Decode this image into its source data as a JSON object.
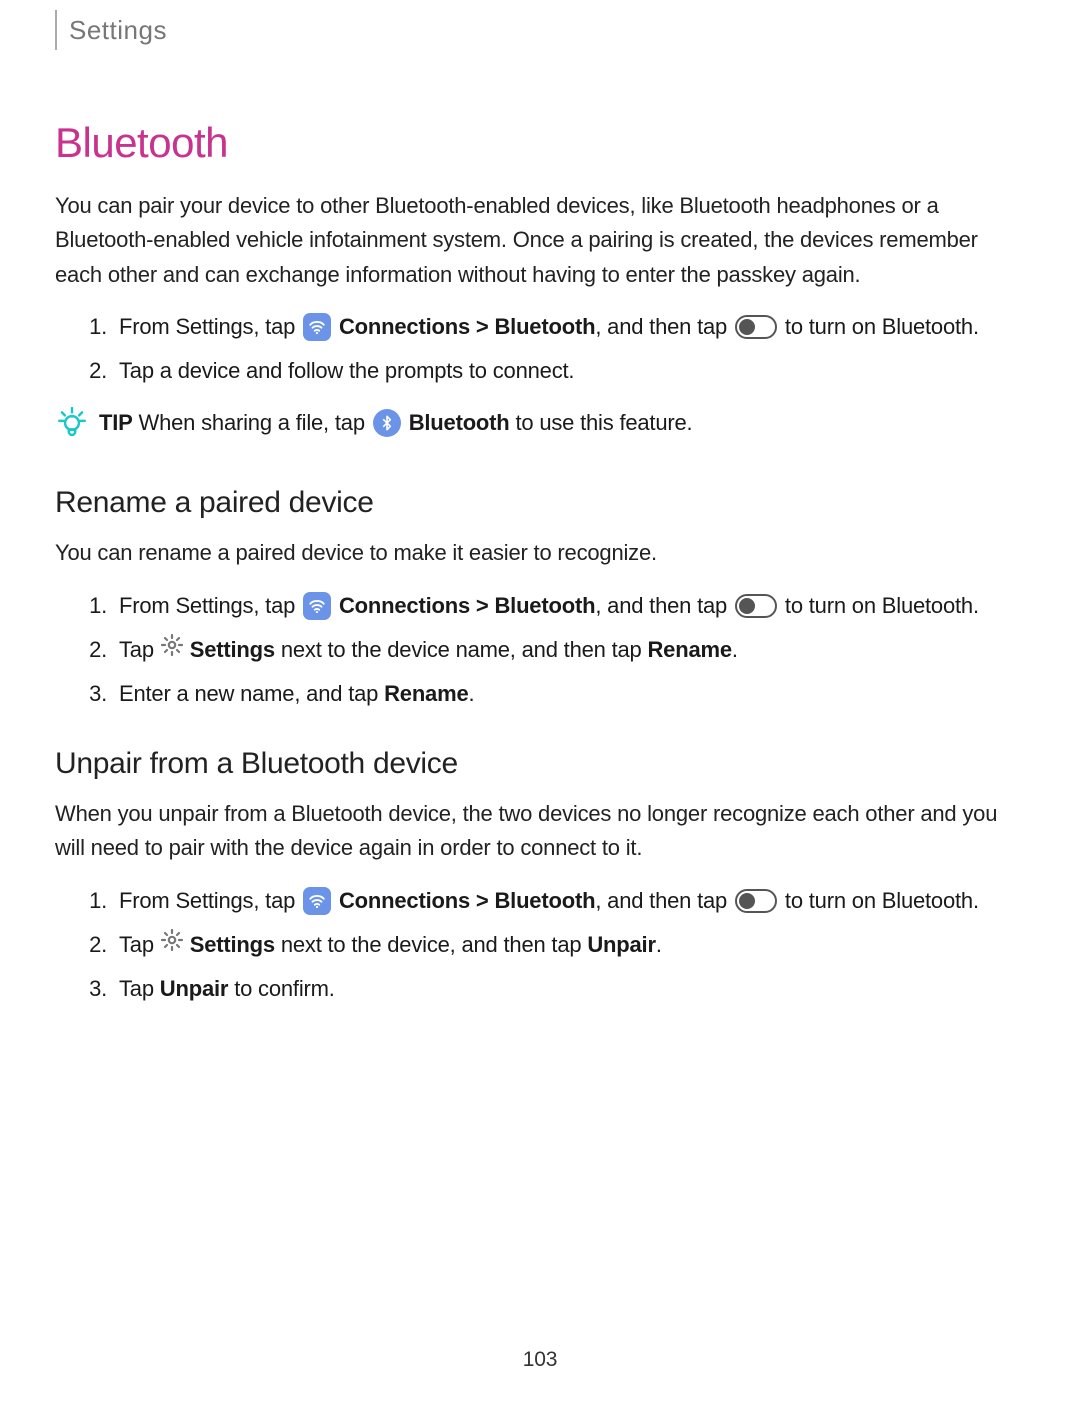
{
  "breadcrumb": "Settings",
  "h1": "Bluetooth",
  "intro1": "You can pair your device to other Bluetooth-enabled devices, like Bluetooth headphones or a Bluetooth-enabled vehicle infotainment system. Once a pairing is created, the devices remember each other and can exchange information without having to enter the passkey again.",
  "step1_part1": "From Settings, tap ",
  "step1_conn": " Connections > Bluetooth",
  "step1_part2": ", and then tap ",
  "step1_part3": " to turn on Bluetooth.",
  "step2": "Tap a device and follow the prompts to connect.",
  "tip_label": "TIP",
  "tip_part1": "  When sharing a file, tap ",
  "tip_bt": " Bluetooth",
  "tip_part2": " to use this feature.",
  "h2a": "Rename a paired device",
  "intro2": "You can rename a paired device to make it easier to recognize.",
  "rename_s1_p1": "From Settings, tap ",
  "rename_s1_conn": " Connections > Bluetooth",
  "rename_s1_p2": ", and then tap ",
  "rename_s1_p3": " to turn on Bluetooth.",
  "rename_s2_p1": "Tap ",
  "rename_s2_settings": " Settings",
  "rename_s2_p2": " next to the device name, and then tap ",
  "rename_s2_rename": "Rename",
  "rename_s2_p3": ".",
  "rename_s3_p1": "Enter a new name, and tap ",
  "rename_s3_rename": "Rename",
  "rename_s3_p2": ".",
  "h2b": "Unpair from a Bluetooth device",
  "intro3": "When you unpair from a Bluetooth device, the two devices no longer recognize each other and you will need to pair with the device again in order to connect to it.",
  "unpair_s1_p1": "From Settings, tap ",
  "unpair_s1_conn": " Connections > Bluetooth",
  "unpair_s1_p2": ", and then tap ",
  "unpair_s1_p3": " to turn on Bluetooth.",
  "unpair_s2_p1": "Tap ",
  "unpair_s2_settings": " Settings",
  "unpair_s2_p2": " next to the device, and then tap ",
  "unpair_s2_unpair": "Unpair",
  "unpair_s2_p3": ".",
  "unpair_s3_p1": "Tap ",
  "unpair_s3_unpair": "Unpair",
  "unpair_s3_p2": " to confirm.",
  "page_number": "103"
}
